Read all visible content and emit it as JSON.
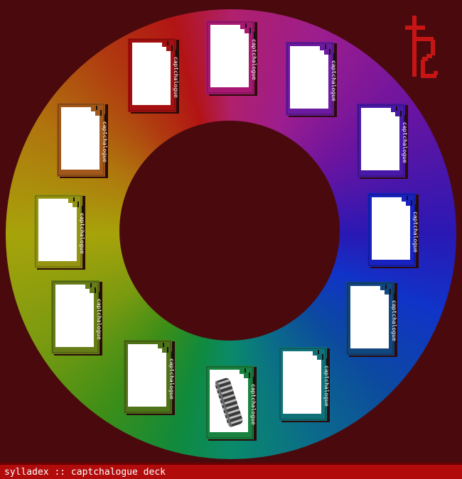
{
  "app": {
    "footer_text": "sylladex :: captchalogue deck"
  },
  "symbol": {
    "name": "saturn-symbol-icon",
    "color": "#c71515"
  },
  "cards": [
    {
      "name": "card-magenta",
      "label": "captchalogue",
      "color": "#a81873",
      "item": ""
    },
    {
      "name": "card-purple",
      "label": "captchalogue",
      "color": "#6c1aa0",
      "item": ""
    },
    {
      "name": "card-violet",
      "label": "captchalogue",
      "color": "#4a18a8",
      "item": ""
    },
    {
      "name": "card-blue",
      "label": "captchalogue",
      "color": "#1822c0",
      "item": ""
    },
    {
      "name": "card-steel",
      "label": "captchalogue",
      "color": "#12467e",
      "item": ""
    },
    {
      "name": "card-teal",
      "label": "captchalogue",
      "color": "#0e7278",
      "item": ""
    },
    {
      "name": "card-green",
      "label": "captchalogue",
      "color": "#1a8240",
      "item": "wrapped-object-icon"
    },
    {
      "name": "card-olive",
      "label": "captchalogue",
      "color": "#4f7318",
      "item": ""
    },
    {
      "name": "card-lime",
      "label": "captchalogue",
      "color": "#677d17",
      "item": ""
    },
    {
      "name": "card-yellow",
      "label": "captchalogue",
      "color": "#949412",
      "item": ""
    },
    {
      "name": "card-orange",
      "label": "captchalogue",
      "color": "#a2581a",
      "item": ""
    },
    {
      "name": "card-red",
      "label": "captchalogue",
      "color": "#a41010",
      "item": ""
    }
  ]
}
